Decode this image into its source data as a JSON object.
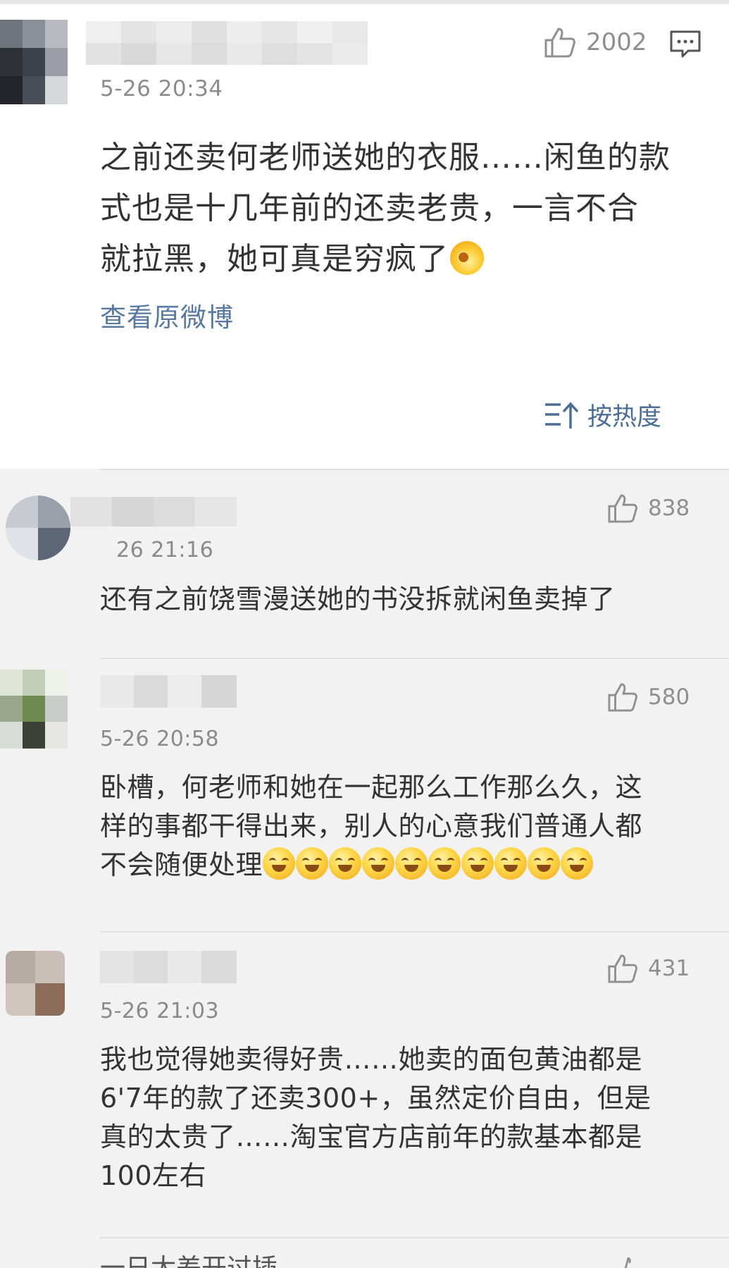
{
  "main_post": {
    "time": "5-26 20:34",
    "likes": "2002",
    "text_lines": [
      "之前还卖何老师送她的衣服……闲鱼的款",
      "式也是十几年前的还卖老贵，一言不合",
      "就拉黑，她可真是穷疯了"
    ],
    "view_original_label": "查看原微博",
    "sort_label": "按热度"
  },
  "comments": [
    {
      "time": "26 21:16",
      "likes": "838",
      "text_lines": [
        "还有之前饶雪漫送她的书没拆就闲鱼卖掉了"
      ]
    },
    {
      "time": "5-26 20:58",
      "likes": "580",
      "text_lines": [
        "卧槽，何老师和她在一起那么工作那么久，这",
        "样的事都干得出来，别人的心意我们普通人都",
        "不会随便处理"
      ]
    },
    {
      "time": "5-26 21:03",
      "likes": "431",
      "text_lines": [
        "我也觉得她卖得好贵……她卖的面包黄油都是",
        "6'7年的款了还卖300+，虽然定价自由，但是",
        "真的太贵了……淘宝官方店前年的款基本都是",
        "100左右"
      ]
    }
  ],
  "bottom_peek_text": "一日太差开过插",
  "colors": {
    "link_blue": "#58799f",
    "sort_blue": "#4c6e93",
    "muted_gray": "#8c8c8c",
    "text": "#333333",
    "main_bg": "#ffffff",
    "comment_bg": "#f2f2f2"
  },
  "icons": {
    "like": "thumbs-up-icon",
    "reply": "comment-bubble-icon",
    "sort": "sort-hot-icon",
    "emoji_main": "yawn-emoji-icon",
    "emoji_repeat": "grin-emoji-icon"
  }
}
